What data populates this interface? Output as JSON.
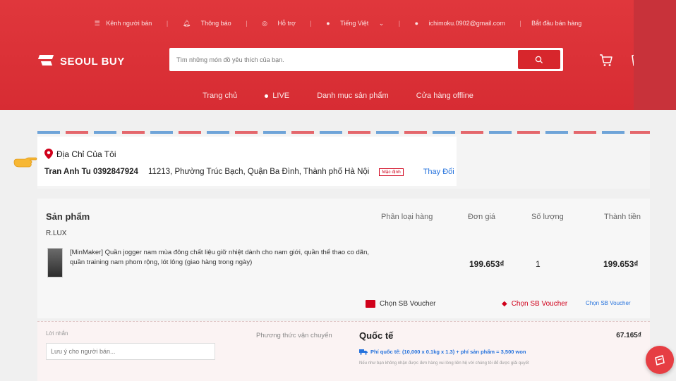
{
  "colors": {
    "brand_red": "#d7262c",
    "link_blue": "#2673dd"
  },
  "topbar": {
    "seller_channel": "Kênh người bán",
    "notifications": "Thông báo",
    "support": "Hỗ trợ",
    "language": "Tiếng Việt",
    "email": "ichimoku.0902@gmail.com",
    "start_selling": "Bắt đầu bán hàng"
  },
  "header": {
    "logo_text": "SEOUL BUY",
    "search_placeholder": "Tìm những món đồ yêu thích của bạn."
  },
  "nav": [
    "Trang chủ",
    "LIVE",
    "Danh mục sản phẩm",
    "Cửa hàng offline"
  ],
  "address": {
    "title": "Địa Chỉ Của Tôi",
    "name_phone": "Tran Anh Tu 0392847924",
    "address_text": "11213, Phường Trúc Bạch, Quận Ba Đình, Thành phố Hà Nội",
    "default_badge": "Mặc định",
    "change_label": "Thay Đổi"
  },
  "products": {
    "header": {
      "title": "Sản phẩm",
      "variant": "Phân loại hàng",
      "unit_price": "Đơn giá",
      "quantity": "Số lượng",
      "total": "Thành tiền"
    },
    "shop_name": "R.LUX",
    "items": [
      {
        "name": "[MinMaker] Quần jogger nam mùa đông chất liệu giữ nhiệt dành cho nam giới, quần thể thao co dãn, quần training nam phom rộng, lót lông (giao hàng trong ngày)",
        "unit_price": "199.653₫",
        "quantity": "1",
        "total": "199.653₫"
      }
    ],
    "vouchers": [
      "Chọn SB Voucher",
      "Chọn SB Voucher",
      "Chọn SB Voucher"
    ]
  },
  "shipping": {
    "message_label": "Lời nhắn",
    "message_placeholder": "Lưu ý cho người bán...",
    "method_label": "Phương thức vận chuyển",
    "method": "Quốc tế",
    "price": "67.165₫",
    "fee_detail": "Phí quốc tế: (10,000 x 0.1kg x 1.3) + phí sản phẩm = 3,500 won",
    "note": "Nếu như bạn không nhận được đơn hàng vui lòng liên hệ với chúng tôi để được giải quyết"
  },
  "icons": [
    "menu-icon",
    "bell-icon",
    "headset-icon",
    "globe-icon",
    "avatar-icon",
    "search-icon",
    "cart-icon",
    "bag-icon",
    "location-pin-icon",
    "pointing-hand-icon",
    "voucher-icon",
    "truck-icon",
    "chat-icon"
  ]
}
